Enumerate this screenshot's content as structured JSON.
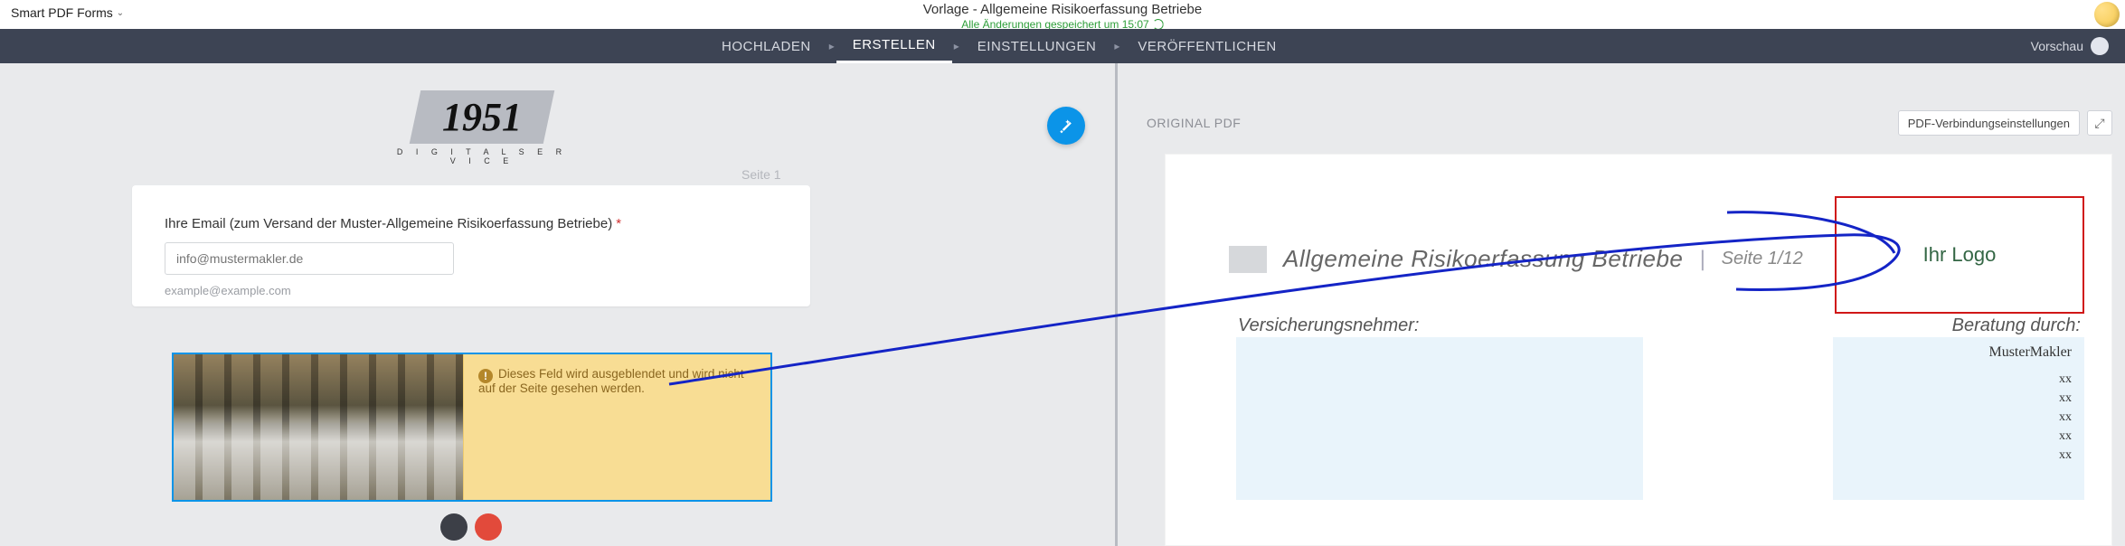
{
  "header": {
    "brand": "Smart PDF Forms",
    "doc_title": "Vorlage - Allgemeine Risikoerfassung Betriebe",
    "saved_status": "Alle Änderungen gespeichert um 15:07"
  },
  "stepbar": {
    "steps": [
      "HOCHLADEN",
      "ERSTELLEN",
      "EINSTELLUNGEN",
      "VERÖFFENTLICHEN"
    ],
    "active_index": 1,
    "preview_label": "Vorschau"
  },
  "editor": {
    "logo_year": "1951",
    "logo_sub": "D I G I T A L S E R V I C E",
    "page_label": "Seite 1",
    "email_field": {
      "label": "Ihre Email (zum Versand der Muster-Allgemeine Risikoerfassung Betriebe)",
      "placeholder": "info@mustermakler.de",
      "hint": "example@example.com"
    },
    "hidden_warning": "Dieses Feld wird ausgeblendet und wird nicht auf der Seite gesehen werden."
  },
  "pdf_panel": {
    "header": "ORIGINAL PDF",
    "connection_btn": "PDF-Verbindungseinstellungen",
    "doc_title": "Allgemeine Risikoerfassung Betriebe",
    "page_indicator": "Seite 1/12",
    "logo_placeholder": "Ihr Logo",
    "vn_label": "Versicherungsnehmer:",
    "beratung_label": "Beratung durch:",
    "beratung_name": "MusterMakler",
    "beratung_lines": [
      "xx",
      "xx",
      "xx",
      "xx",
      "xx"
    ]
  }
}
